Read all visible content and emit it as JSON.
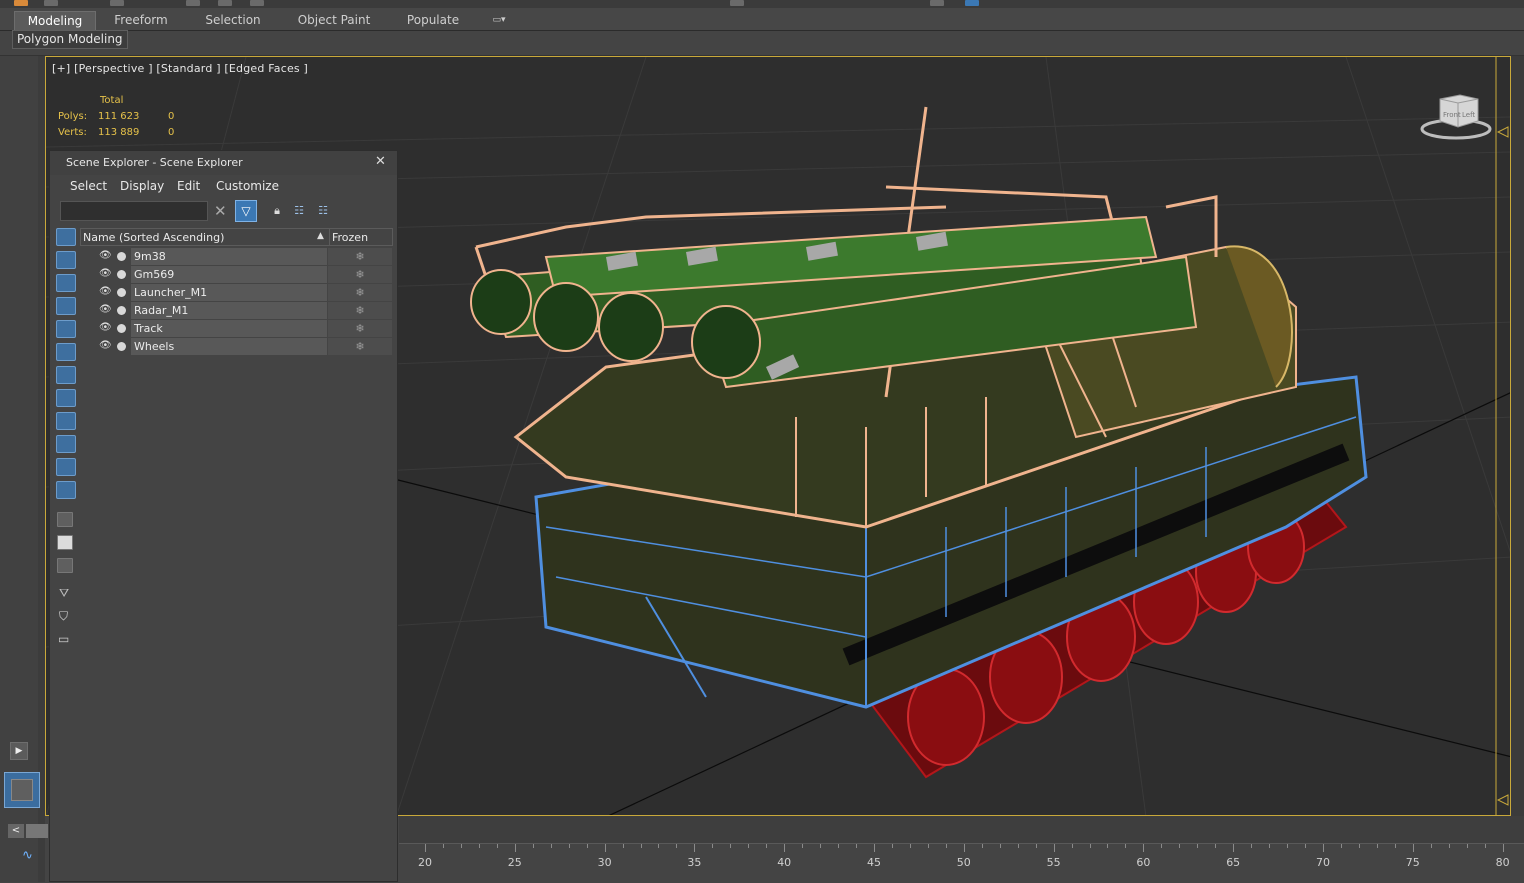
{
  "ribbon": {
    "tabs": [
      "Modeling",
      "Freeform",
      "Selection",
      "Object Paint",
      "Populate"
    ],
    "active_tab": "Modeling",
    "sub_label": "Polygon Modeling"
  },
  "viewport": {
    "label": "[+] [Perspective ] [Standard ] [Edged Faces ]",
    "stats": {
      "header": "Total",
      "polys_label": "Polys:",
      "polys_value": "111 623",
      "polys_sel": "0",
      "verts_label": "Verts:",
      "verts_value": "113 889",
      "verts_sel": "0"
    },
    "navcube_labels": [
      "Front",
      "Left"
    ]
  },
  "scene_explorer": {
    "title": "Scene Explorer - Scene Explorer",
    "menu": [
      "Select",
      "Display",
      "Edit",
      "Customize"
    ],
    "search_value": "",
    "column_name": "Name (Sorted Ascending)",
    "column_frozen": "Frozen",
    "objects": [
      {
        "name": "9m38"
      },
      {
        "name": "Gm569"
      },
      {
        "name": "Launcher_M1"
      },
      {
        "name": "Radar_M1"
      },
      {
        "name": "Track"
      },
      {
        "name": "Wheels"
      }
    ]
  },
  "timeline": {
    "labels": [
      "20",
      "25",
      "30",
      "35",
      "40",
      "45",
      "50",
      "55",
      "60",
      "65",
      "70",
      "75",
      "80"
    ]
  },
  "colors": {
    "accent_yellow": "#c9a93a",
    "selected_blue": "#3b78b4",
    "wire_peach": "#f0b48e",
    "wire_blue": "#4f8fe0",
    "wire_red": "#b3161a",
    "model_green": "#3c5f24"
  }
}
